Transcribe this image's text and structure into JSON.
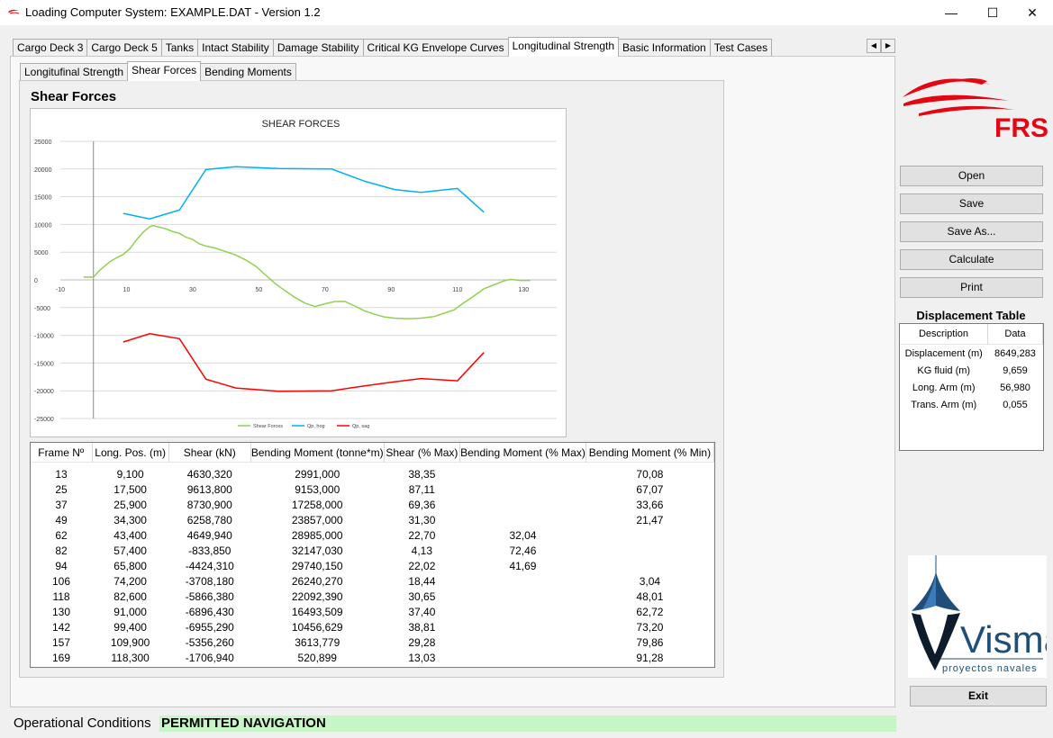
{
  "window": {
    "title": "Loading Computer System: EXAMPLE.DAT - Version 1.2",
    "minimize": "—",
    "maximize": "☐",
    "close": "✕"
  },
  "main_tabs": [
    "Cargo Deck 3",
    "Cargo Deck 5",
    "Tanks",
    "Intact Stability",
    "Damage Stability",
    "Critical KG Envelope Curves",
    "Longitudinal Strength",
    "Basic Information",
    "Test Cases"
  ],
  "active_main_tab": 6,
  "tab_scroll": {
    "left": "◀",
    "right": "▶"
  },
  "sub_tabs": [
    "Longitufinal Strength",
    "Shear Forces",
    "Bending Moments"
  ],
  "active_sub_tab": 1,
  "section_title": "Shear Forces",
  "chart_data": {
    "type": "line",
    "title": "SHEAR FORCES",
    "xlim": [
      -10,
      140
    ],
    "ylim": [
      -25000,
      25000
    ],
    "x_ticks": [
      -10,
      10,
      30,
      50,
      70,
      90,
      110,
      130
    ],
    "y_ticks": [
      25000,
      20000,
      15000,
      10000,
      5000,
      0,
      -5000,
      -10000,
      -15000,
      -20000,
      -25000
    ],
    "y_axis_at_x": 0,
    "grid": true,
    "legend_position": "bottom",
    "series": [
      {
        "name": "Shear Forces",
        "color": "#92d050",
        "points": [
          [
            -3,
            500
          ],
          [
            0,
            500
          ],
          [
            2,
            1800
          ],
          [
            5,
            3300
          ],
          [
            7,
            4000
          ],
          [
            9,
            4600
          ],
          [
            11,
            5600
          ],
          [
            13,
            7200
          ],
          [
            15,
            8600
          ],
          [
            17,
            9600
          ],
          [
            18,
            9800
          ],
          [
            20,
            9500
          ],
          [
            22,
            9200
          ],
          [
            24,
            8700
          ],
          [
            26,
            8400
          ],
          [
            28,
            7700
          ],
          [
            30,
            7300
          ],
          [
            32,
            6500
          ],
          [
            34,
            6100
          ],
          [
            37,
            5700
          ],
          [
            40,
            5100
          ],
          [
            43,
            4500
          ],
          [
            46,
            3600
          ],
          [
            49,
            2500
          ],
          [
            52,
            900
          ],
          [
            55,
            -700
          ],
          [
            58,
            -2000
          ],
          [
            61,
            -3200
          ],
          [
            64,
            -4200
          ],
          [
            67,
            -4800
          ],
          [
            70,
            -4300
          ],
          [
            73,
            -3900
          ],
          [
            76,
            -3900
          ],
          [
            79,
            -4700
          ],
          [
            82,
            -5600
          ],
          [
            85,
            -6200
          ],
          [
            88,
            -6700
          ],
          [
            91,
            -6900
          ],
          [
            95,
            -7000
          ],
          [
            99,
            -6900
          ],
          [
            103,
            -6600
          ],
          [
            106,
            -6000
          ],
          [
            109,
            -5400
          ],
          [
            112,
            -4100
          ],
          [
            115,
            -2900
          ],
          [
            118,
            -1600
          ],
          [
            121,
            -900
          ],
          [
            124,
            -200
          ],
          [
            126,
            100
          ],
          [
            129,
            -100
          ],
          [
            132,
            -100
          ]
        ]
      },
      {
        "name": "Qp, hog",
        "color": "#00b0f0",
        "points": [
          [
            9,
            12000
          ],
          [
            17,
            11000
          ],
          [
            26,
            12600
          ],
          [
            34,
            19900
          ],
          [
            43,
            20400
          ],
          [
            56,
            20100
          ],
          [
            72,
            20000
          ],
          [
            82,
            17800
          ],
          [
            91,
            16300
          ],
          [
            99,
            15800
          ],
          [
            110,
            16500
          ],
          [
            118,
            12200
          ]
        ]
      },
      {
        "name": "Qp, sag",
        "color": "#ff0000",
        "points": [
          [
            9,
            -11200
          ],
          [
            17,
            -9700
          ],
          [
            26,
            -10600
          ],
          [
            34,
            -17900
          ],
          [
            43,
            -19500
          ],
          [
            56,
            -20100
          ],
          [
            72,
            -20000
          ],
          [
            82,
            -19100
          ],
          [
            91,
            -18400
          ],
          [
            99,
            -17800
          ],
          [
            110,
            -18200
          ],
          [
            118,
            -13100
          ]
        ]
      }
    ]
  },
  "results_table": {
    "headers": [
      "Frame Nº",
      "Long. Pos. (m)",
      "Shear (kN)",
      "Bending Moment (tonne*m)",
      "Shear (% Max)",
      "Bending Moment (% Max)",
      "Bending Moment (% Min)"
    ],
    "rows": [
      [
        "13",
        "9,100",
        "4630,320",
        "2991,000",
        "38,35",
        "",
        "70,08"
      ],
      [
        "25",
        "17,500",
        "9613,800",
        "9153,000",
        "87,11",
        "",
        "67,07"
      ],
      [
        "37",
        "25,900",
        "8730,900",
        "17258,000",
        "69,36",
        "",
        "33,66"
      ],
      [
        "49",
        "34,300",
        "6258,780",
        "23857,000",
        "31,30",
        "",
        "21,47"
      ],
      [
        "62",
        "43,400",
        "4649,940",
        "28985,000",
        "22,70",
        "32,04",
        ""
      ],
      [
        "82",
        "57,400",
        "-833,850",
        "32147,030",
        "4,13",
        "72,46",
        ""
      ],
      [
        "94",
        "65,800",
        "-4424,310",
        "29740,150",
        "22,02",
        "41,69",
        ""
      ],
      [
        "106",
        "74,200",
        "-3708,180",
        "26240,270",
        "18,44",
        "",
        "3,04"
      ],
      [
        "118",
        "82,600",
        "-5866,380",
        "22092,390",
        "30,65",
        "",
        "48,01"
      ],
      [
        "130",
        "91,000",
        "-6896,430",
        "16493,509",
        "37,40",
        "",
        "62,72"
      ],
      [
        "142",
        "99,400",
        "-6955,290",
        "10456,629",
        "38,81",
        "",
        "73,20"
      ],
      [
        "157",
        "109,900",
        "-5356,260",
        "3613,779",
        "29,28",
        "",
        "79,86"
      ],
      [
        "169",
        "118,300",
        "-1706,940",
        "520,899",
        "13,03",
        "",
        "91,28"
      ]
    ]
  },
  "logo_frs": {
    "text": "FRS",
    "color": "#e30613"
  },
  "buttons": {
    "open": "Open",
    "save": "Save",
    "save_as": "Save As...",
    "calculate": "Calculate",
    "print": "Print",
    "exit": "Exit"
  },
  "displacement_table": {
    "title": "Displacement Table",
    "headers": [
      "Description",
      "Data"
    ],
    "rows": [
      [
        "Displacement (m)",
        "8649,283"
      ],
      [
        "KG fluid (m)",
        "9,659"
      ],
      [
        "Long. Arm (m)",
        "56,980"
      ],
      [
        "Trans. Arm (m)",
        "0,055"
      ]
    ]
  },
  "logo_visma": {
    "name": "Visma",
    "tagline": "proyectos navales",
    "color": "#1f4e79"
  },
  "operational": {
    "label": "Operational Conditions",
    "status": "PERMITTED NAVIGATION",
    "status_color": "#c6f5c6"
  }
}
